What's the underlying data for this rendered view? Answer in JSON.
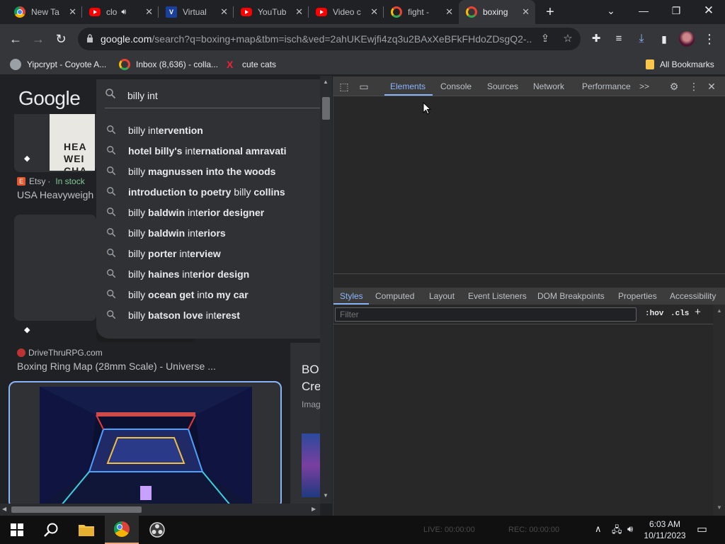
{
  "tabs": [
    {
      "title": "New Ta",
      "icon": "chrome-icon"
    },
    {
      "title": "clo",
      "icon": "youtube-icon",
      "audio": true
    },
    {
      "title": "Virtual",
      "icon": "virtualbox-icon"
    },
    {
      "title": "YouTub",
      "icon": "youtube-icon"
    },
    {
      "title": "Video c",
      "icon": "youtube-icon"
    },
    {
      "title": "fight - ",
      "icon": "google-icon"
    },
    {
      "title": "boxing",
      "icon": "google-icon",
      "active": true
    }
  ],
  "address": {
    "host": "google.com",
    "path": "/search?q=boxing+map&tbm=isch&ved=2ahUKEwjfi4zq3u2BAxXeBFkFHdoZDsgQ2-..."
  },
  "bookmarks": [
    {
      "label": "Yipcrypt - Coyote A...",
      "icon": "globe-icon"
    },
    {
      "label": "Inbox (8,636) - colla...",
      "icon": "google-icon"
    },
    {
      "label": "cute cats",
      "icon": "x-icon"
    }
  ],
  "all_bookmarks": "All Bookmarks",
  "page": {
    "logo": "Google",
    "search_query": "billy int",
    "book_text": "HEA\nWEI\nCHA",
    "result1_source": "Etsy",
    "result1_stock": "In stock",
    "result1_title": "USA Heavyweigh",
    "result2_source": "DriveThruRPG.com",
    "result2_title": "Boxing Ring Map (28mm Scale) - Universe ...",
    "side_title": "BO\nCre",
    "side_sub": "Imag"
  },
  "suggestions": [
    {
      "pre": "billy int",
      "bold": "ervention",
      "post": ""
    },
    {
      "pre": "",
      "bold": "hotel billy's",
      "post": " international amravati",
      "mixed": [
        [
          "b",
          "hotel billy's "
        ],
        [
          "n",
          "int"
        ],
        [
          "b",
          "ernational amravati"
        ]
      ]
    },
    {
      "mixed": [
        [
          "n",
          "billy "
        ],
        [
          "b",
          "magnussen into the woods"
        ]
      ]
    },
    {
      "mixed": [
        [
          "b",
          "introduction to poetry "
        ],
        [
          "n",
          "billy "
        ],
        [
          "b",
          "collins"
        ]
      ]
    },
    {
      "mixed": [
        [
          "n",
          "billy "
        ],
        [
          "b",
          "baldwin "
        ],
        [
          "n",
          "int"
        ],
        [
          "b",
          "erior designer"
        ]
      ]
    },
    {
      "mixed": [
        [
          "n",
          "billy "
        ],
        [
          "b",
          "baldwin "
        ],
        [
          "n",
          "int"
        ],
        [
          "b",
          "eriors"
        ]
      ]
    },
    {
      "mixed": [
        [
          "n",
          "billy "
        ],
        [
          "b",
          "porter "
        ],
        [
          "n",
          "int"
        ],
        [
          "b",
          "erview"
        ]
      ]
    },
    {
      "mixed": [
        [
          "n",
          "billy "
        ],
        [
          "b",
          "haines "
        ],
        [
          "n",
          "int"
        ],
        [
          "b",
          "erior design"
        ]
      ]
    },
    {
      "mixed": [
        [
          "n",
          "billy "
        ],
        [
          "b",
          "ocean get "
        ],
        [
          "n",
          "int"
        ],
        [
          "b",
          "o my car"
        ]
      ]
    },
    {
      "mixed": [
        [
          "n",
          "billy "
        ],
        [
          "b",
          "batson love "
        ],
        [
          "n",
          "int"
        ],
        [
          "b",
          "erest"
        ]
      ]
    }
  ],
  "devtools": {
    "tabs": [
      "Elements",
      "Console",
      "Sources",
      "Network",
      "Performance"
    ],
    "more": ">>",
    "subtabs": [
      "Styles",
      "Computed",
      "Layout",
      "Event Listeners",
      "DOM Breakpoints",
      "Properties",
      "Accessibility"
    ],
    "filter_placeholder": "Filter",
    "hov": ":hov",
    "cls": ".cls",
    "plus": "+"
  },
  "taskbar": {
    "live": "LIVE: 00:00:00",
    "rec": "REC: 00:00:00",
    "time": "6:03 AM",
    "date": "10/11/2023"
  },
  "colors": {
    "accent": "#8ab4f8",
    "in_stock": "#81c995",
    "youtube": "#ff0000"
  }
}
